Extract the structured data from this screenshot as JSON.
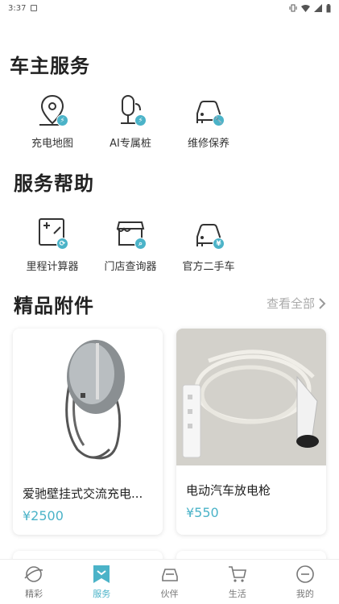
{
  "status_bar": {
    "time": "3:37"
  },
  "sections": {
    "owner_services": {
      "title": "车主服务",
      "items": [
        {
          "label": "充电地图",
          "icon": "map-pin-charge-icon"
        },
        {
          "label": "AI专属桩",
          "icon": "charging-pile-icon"
        },
        {
          "label": "维修保养",
          "icon": "car-wrench-icon"
        }
      ]
    },
    "service_help": {
      "title": "服务帮助",
      "items": [
        {
          "label": "里程计算器",
          "icon": "calculator-icon"
        },
        {
          "label": "门店查询器",
          "icon": "store-search-icon"
        },
        {
          "label": "官方二手车",
          "icon": "used-car-icon"
        }
      ]
    },
    "accessories": {
      "title": "精品附件",
      "view_all": "查看全部",
      "products": [
        {
          "name": "爱驰壁挂式交流充电...",
          "price": "¥2500"
        },
        {
          "name": "电动汽车放电枪",
          "price": "¥550"
        }
      ]
    }
  },
  "bottom_nav": [
    {
      "label": "精彩",
      "icon": "planet-icon",
      "active": false
    },
    {
      "label": "服务",
      "icon": "bookmark-icon",
      "active": true
    },
    {
      "label": "伙伴",
      "icon": "car-front-icon",
      "active": false
    },
    {
      "label": "生活",
      "icon": "cart-icon",
      "active": false
    },
    {
      "label": "我的",
      "icon": "profile-icon",
      "active": false
    }
  ],
  "colors": {
    "accent": "#4bb3c8",
    "muted": "#aaaaaa"
  }
}
